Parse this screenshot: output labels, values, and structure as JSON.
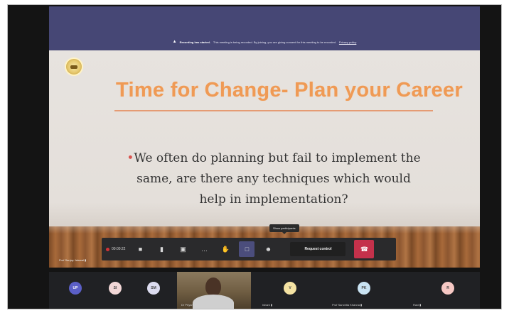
{
  "recording_banner": {
    "heading": "Recording has started.",
    "message": "This meeting is being recorded. By joining, you are giving consent for this meeting to be recorded.",
    "link": "Privacy policy"
  },
  "slide": {
    "title": "Time for Change- Plan your Career",
    "bullet": "We often do planning but fail to implement the same, are there any techniques which would help in implementation?"
  },
  "call_controls": {
    "timer": "00:00:22",
    "tooltip": "Show participants",
    "request_control_label": "Request control"
  },
  "presenter": {
    "name": "Prof Sanjay Jaiswal"
  },
  "participants": [
    {
      "initials": "UP",
      "name": "",
      "color": "#5b5fc7"
    },
    {
      "initials": "SI",
      "name": "",
      "color": "#f2d7d7"
    },
    {
      "initials": "SM",
      "name": "",
      "color": "#dcdcf0"
    },
    {
      "initials": "",
      "name": "Dr Priyanka",
      "video": true
    },
    {
      "initials": "V",
      "name": "Ishani",
      "color": "#f5e3a3"
    },
    {
      "initials": "PK",
      "name": "Prof Sanchita Khanna",
      "color": "#c9e3f3"
    },
    {
      "initials": "R",
      "name": "Ravi",
      "color": "#f6c8c4"
    }
  ]
}
